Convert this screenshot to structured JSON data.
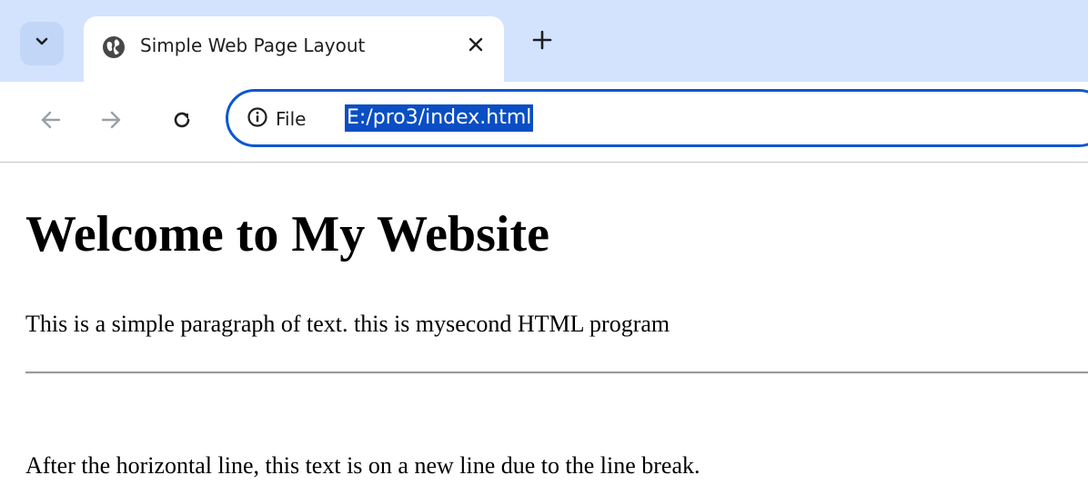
{
  "browser": {
    "tab": {
      "title": "Simple Web Page Layout"
    },
    "toolbar": {
      "site_info_label": "File",
      "url": "E:/pro3/index.html"
    },
    "icons": {
      "tab_search": "chevron-down-icon",
      "favicon": "globe-icon",
      "close_tab": "close-icon",
      "new_tab": "plus-icon",
      "back": "arrow-left-icon",
      "forward": "arrow-right-icon",
      "reload": "reload-icon",
      "site_info": "info-icon"
    },
    "colors": {
      "tabstrip": "#d3e3fd",
      "omnibox_border": "#0b57d0",
      "url_selection": "#0a4ec4"
    }
  },
  "page": {
    "heading": "Welcome to My Website",
    "paragraph": "This is a simple paragraph of text. this is mysecond HTML program",
    "paragraph_after_line": "After the horizontal line, this text is on a new line due to the line break."
  }
}
